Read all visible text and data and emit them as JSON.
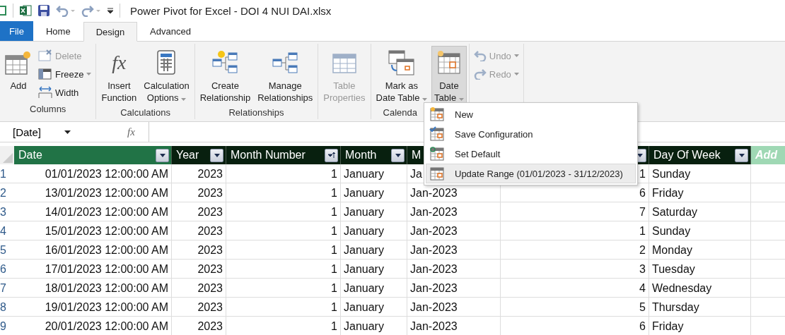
{
  "window": {
    "title": "Power Pivot for Excel - DOI 4 NUI DAI.xlsx"
  },
  "tabs": [
    {
      "label": "File",
      "kind": "file",
      "selected": false
    },
    {
      "label": "Home",
      "kind": "tab",
      "selected": false
    },
    {
      "label": "Design",
      "kind": "tab",
      "selected": true
    },
    {
      "label": "Advanced",
      "kind": "tab",
      "selected": false
    }
  ],
  "ribbon": {
    "groups": [
      {
        "label": "Columns",
        "buttons": [
          {
            "kind": "large",
            "lines": [
              "Add"
            ],
            "disabled": false,
            "dropdown": false,
            "pressed": false
          },
          {
            "kind": "small",
            "lines": [
              "Delete"
            ],
            "disabled": true,
            "dropdown": false,
            "pressed": false
          },
          {
            "kind": "small",
            "lines": [
              "Freeze"
            ],
            "disabled": false,
            "dropdown": true,
            "pressed": false
          },
          {
            "kind": "small",
            "lines": [
              "Width"
            ],
            "disabled": false,
            "dropdown": false,
            "pressed": false
          }
        ]
      },
      {
        "label": "Calculations",
        "buttons": [
          {
            "kind": "large",
            "glyph": "fx",
            "lines": [
              "Insert",
              "Function"
            ],
            "disabled": false,
            "dropdown": false,
            "pressed": false
          },
          {
            "kind": "large",
            "lines": [
              "Calculation",
              "Options"
            ],
            "disabled": false,
            "dropdown": true,
            "pressed": false
          }
        ]
      },
      {
        "label": "Relationships",
        "buttons": [
          {
            "kind": "large",
            "lines": [
              "Create",
              "Relationship"
            ],
            "disabled": false,
            "dropdown": false,
            "pressed": false
          },
          {
            "kind": "large",
            "lines": [
              "Manage",
              "Relationships"
            ],
            "disabled": false,
            "dropdown": false,
            "pressed": false
          }
        ]
      },
      {
        "buttons": [
          {
            "kind": "large",
            "lines": [
              "Table",
              "Properties"
            ],
            "disabled": true,
            "dropdown": false,
            "pressed": false
          }
        ]
      },
      {
        "label": "Calenda",
        "buttons": [
          {
            "kind": "large",
            "lines": [
              "Mark as",
              "Date Table"
            ],
            "disabled": false,
            "dropdown": true,
            "pressed": false
          },
          {
            "kind": "large",
            "lines": [
              "Date",
              "Table"
            ],
            "disabled": false,
            "dropdown": true,
            "pressed": true
          }
        ]
      },
      {
        "buttons": [
          {
            "kind": "small",
            "lines": [
              "Undo"
            ],
            "disabled": true,
            "dropdown": true,
            "pressed": false
          },
          {
            "kind": "small",
            "lines": [
              "Redo"
            ],
            "disabled": true,
            "dropdown": true,
            "pressed": false
          }
        ]
      }
    ]
  },
  "menu": {
    "items": [
      {
        "label": "New",
        "selected": false
      },
      {
        "label": "Save Configuration",
        "selected": false
      },
      {
        "label": "Set Default",
        "selected": false
      },
      {
        "label": "Update Range",
        "detail": "(01/01/2023 - 31/12/2023)",
        "selected": true
      }
    ]
  },
  "formula_bar": {
    "name_box": "[Date]",
    "fx": "fx"
  },
  "table": {
    "columns": [
      {
        "label": "Date",
        "selected": true,
        "sorted": false
      },
      {
        "label": "Year",
        "selected": false,
        "sorted": false
      },
      {
        "label": "Month Number",
        "selected": false,
        "sorted": true
      },
      {
        "label": "Month",
        "selected": false,
        "sorted": false
      },
      {
        "label": "M",
        "selected": false
      },
      {
        "selected": false,
        "sorted": false
      },
      {
        "label": "Day Of Week",
        "selected": false,
        "sorted": false
      }
    ],
    "add_column": "Add",
    "rows": [
      {
        "number": "1",
        "cells": [
          "01/01/2023 12:00:00 AM",
          "2023",
          "1",
          "January",
          "Ja",
          "1",
          "Sunday"
        ]
      },
      {
        "number": "2",
        "cells": [
          "13/01/2023 12:00:00 AM",
          "2023",
          "1",
          "January",
          "Jan-2023",
          "6",
          "Friday"
        ]
      },
      {
        "number": "3",
        "cells": [
          "14/01/2023 12:00:00 AM",
          "2023",
          "1",
          "January",
          "Jan-2023",
          "7",
          "Saturday"
        ]
      },
      {
        "number": "4",
        "cells": [
          "15/01/2023 12:00:00 AM",
          "2023",
          "1",
          "January",
          "Jan-2023",
          "1",
          "Sunday"
        ]
      },
      {
        "number": "5",
        "cells": [
          "16/01/2023 12:00:00 AM",
          "2023",
          "1",
          "January",
          "Jan-2023",
          "2",
          "Monday"
        ]
      },
      {
        "number": "6",
        "cells": [
          "17/01/2023 12:00:00 AM",
          "2023",
          "1",
          "January",
          "Jan-2023",
          "3",
          "Tuesday"
        ]
      },
      {
        "number": "7",
        "cells": [
          "18/01/2023 12:00:00 AM",
          "2023",
          "1",
          "January",
          "Jan-2023",
          "4",
          "Wednesday"
        ]
      },
      {
        "number": "8",
        "cells": [
          "19/01/2023 12:00:00 AM",
          "2023",
          "1",
          "January",
          "Jan-2023",
          "5",
          "Thursday"
        ]
      },
      {
        "number": "9",
        "cells": [
          "20/01/2023 12:00:00 AM",
          "2023",
          "1",
          "January",
          "Jan-2023",
          "6",
          "Friday"
        ]
      }
    ]
  }
}
